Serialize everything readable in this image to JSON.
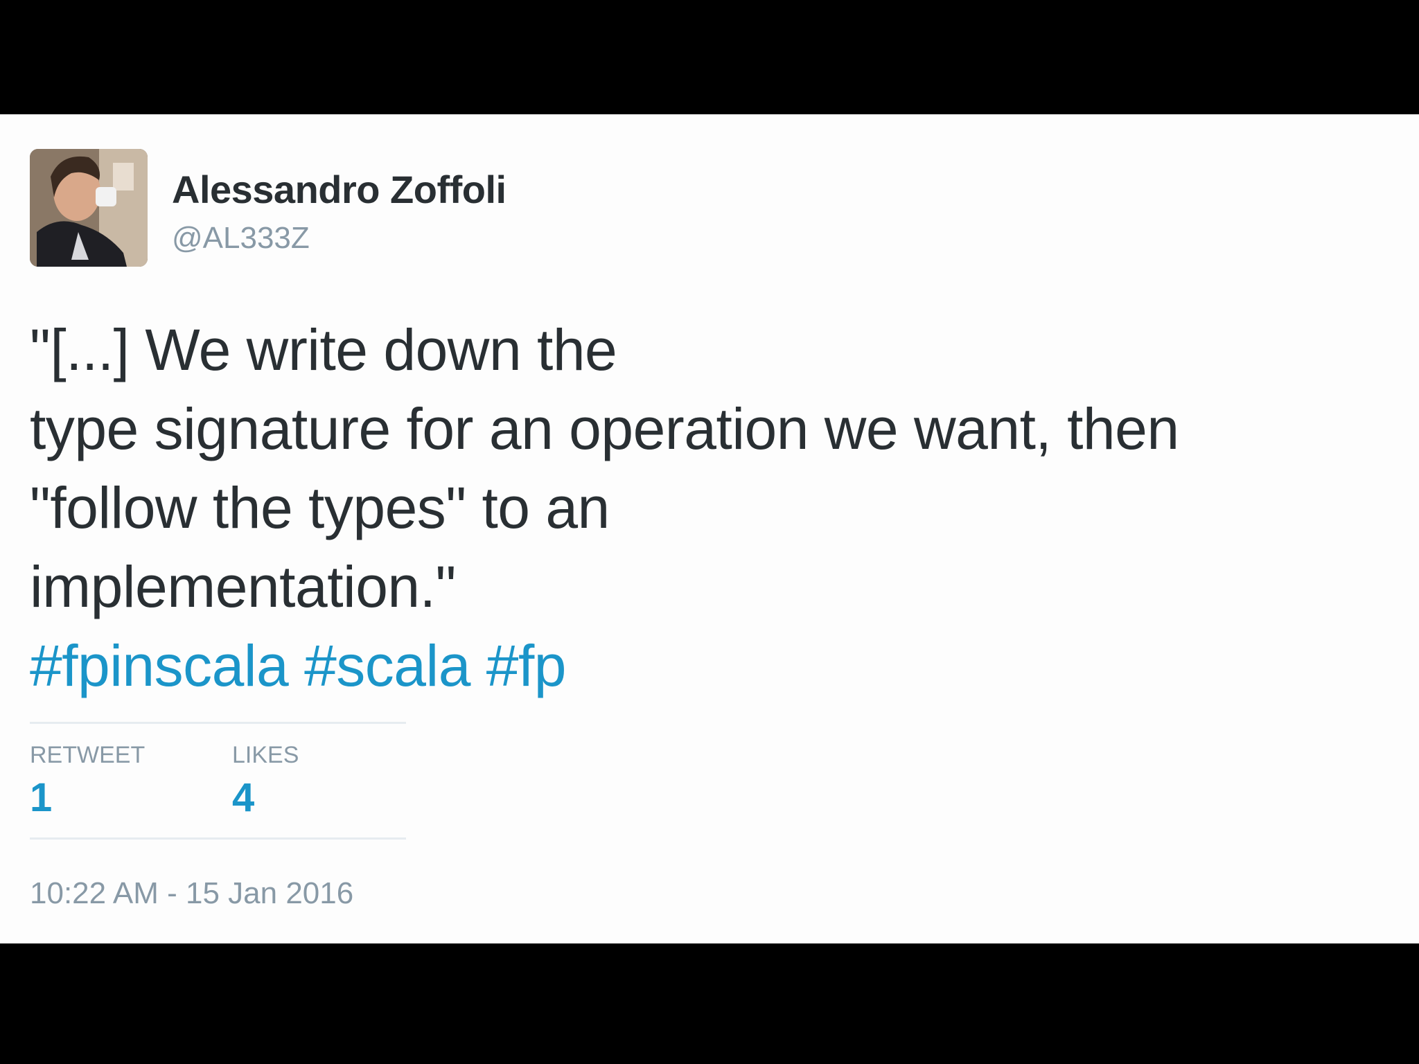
{
  "tweet": {
    "author_name": "Alessandro Zoffoli",
    "author_handle": "@AL333Z",
    "text_lines": [
      "\"[...] We write down the",
      "type signature for an operation we want, then",
      "\"follow the types\" to an",
      "implementation.\""
    ],
    "hashtags": [
      "#fpinscala",
      "#scala",
      "#fp"
    ],
    "stats": {
      "retweets_label": "RETWEET",
      "retweets_value": "1",
      "likes_label": "LIKES",
      "likes_value": "4"
    },
    "timestamp": "10:22 AM - 15 Jan 2016"
  },
  "colors": {
    "background_bar": "#000000",
    "card": "#fdfdfd",
    "text": "#292f33",
    "muted": "#8899a6",
    "link": "#1b95c9"
  }
}
